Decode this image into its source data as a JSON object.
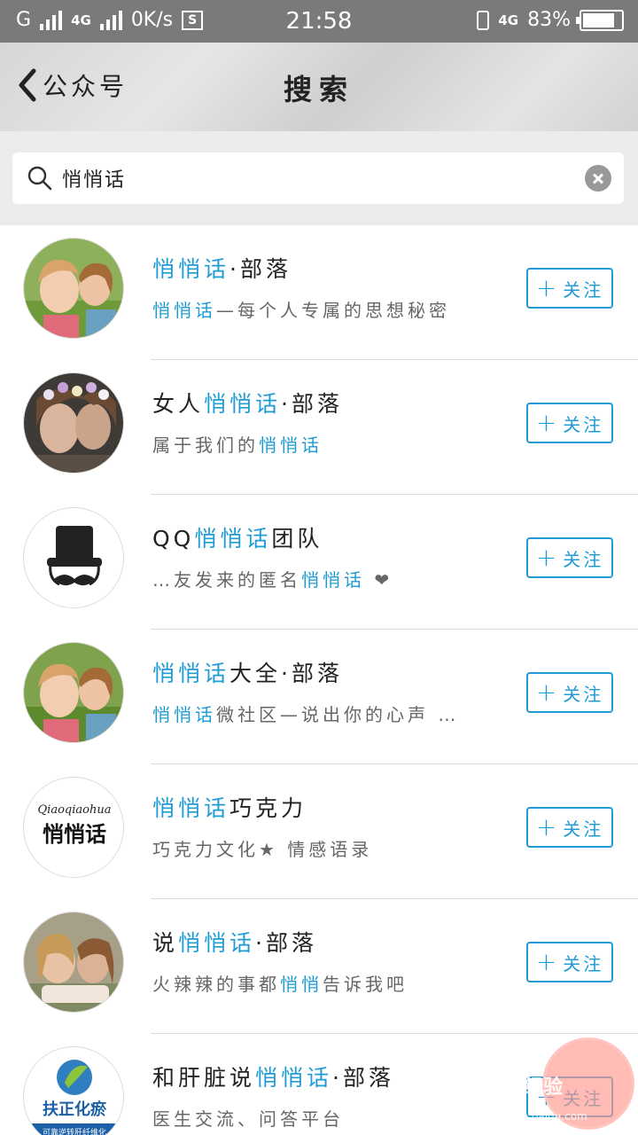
{
  "status_bar": {
    "carrier": "G",
    "network_type": "4G",
    "speed": "0K/s",
    "sim_badge": "S",
    "time": "21:58",
    "network_right": "4G",
    "battery": "83%",
    "battery_level": 0.83
  },
  "header": {
    "back_label": "公众号",
    "title": "搜索"
  },
  "search": {
    "value": "悄悄话"
  },
  "follow_label": "关注",
  "results": [
    {
      "name_pre": "",
      "name_hl": "悄悄话",
      "name_post": "·部落",
      "desc_pre": "",
      "desc_hl": "悄悄话",
      "desc_post": "—每个人专属的思想秘密"
    },
    {
      "name_pre": "女人",
      "name_hl": "悄悄话",
      "name_post": "·部落",
      "desc_pre": "属于我们的",
      "desc_hl": "悄悄话",
      "desc_post": ""
    },
    {
      "name_pre": "QQ",
      "name_hl": "悄悄话",
      "name_post": "团队",
      "desc_pre": "…友发来的匿名",
      "desc_hl": "悄悄话",
      "desc_post": ""
    },
    {
      "name_pre": "",
      "name_hl": "悄悄话",
      "name_post": "大全·部落",
      "desc_pre": "",
      "desc_hl": "悄悄话",
      "desc_post": "微社区—说出你的心声 …"
    },
    {
      "name_pre": "",
      "name_hl": "悄悄话",
      "name_post": "巧克力",
      "desc_pre": "巧克力文化",
      "desc_hl": "",
      "desc_post": " 情感语录"
    },
    {
      "name_pre": "说",
      "name_hl": "悄悄话",
      "name_post": "·部落",
      "desc_pre": "火辣辣的事都",
      "desc_hl": "悄悄",
      "desc_post": "告诉我吧"
    },
    {
      "name_pre": "和肝脏说",
      "name_hl": "悄悄话",
      "name_post": "·部落",
      "desc_pre": "医生交流、问答平台",
      "desc_hl": "",
      "desc_post": ""
    }
  ],
  "avatar_labels": {
    "logo5_top": "Qiaoqiaohua",
    "logo5_main": "悄悄话",
    "logo7_main": "扶正化瘀",
    "logo7_sub": "可靠逆转肝纤维化"
  },
  "watermark": {
    "text": "Bai经验",
    "sub": "jingyan.baidu.com"
  },
  "colors": {
    "accent": "#1f9bd6",
    "status_bar": "#7a7a7a",
    "search_bg": "#ebecee"
  }
}
